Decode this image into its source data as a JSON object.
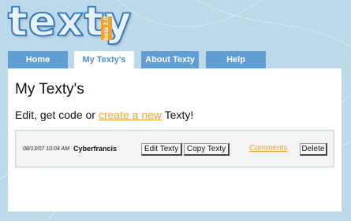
{
  "logo": {
    "text": "texty",
    "badge": "beta 2.0"
  },
  "nav": {
    "tabs": [
      {
        "label": "Home",
        "active": false
      },
      {
        "label": "My Texty's",
        "active": true
      },
      {
        "label": "About Texty",
        "active": false
      },
      {
        "label": "Help",
        "active": false
      }
    ]
  },
  "main": {
    "title": "My Texty's",
    "intro_prefix": "Edit, get code or ",
    "intro_link": "create a new",
    "intro_suffix": " Texty!"
  },
  "list": {
    "items": [
      {
        "timestamp": "08/13/07 10:04 AM",
        "author": "Cyberfrancis",
        "edit_label": "Edit Texty",
        "copy_label": "Copy Texty",
        "comments_label": "Comments",
        "delete_label": "Delete"
      }
    ]
  },
  "colors": {
    "background": "#bcd9ea",
    "tab": "#5f9dd3",
    "accent_link": "#f0a230",
    "logo_blue": "#3f84c4"
  }
}
